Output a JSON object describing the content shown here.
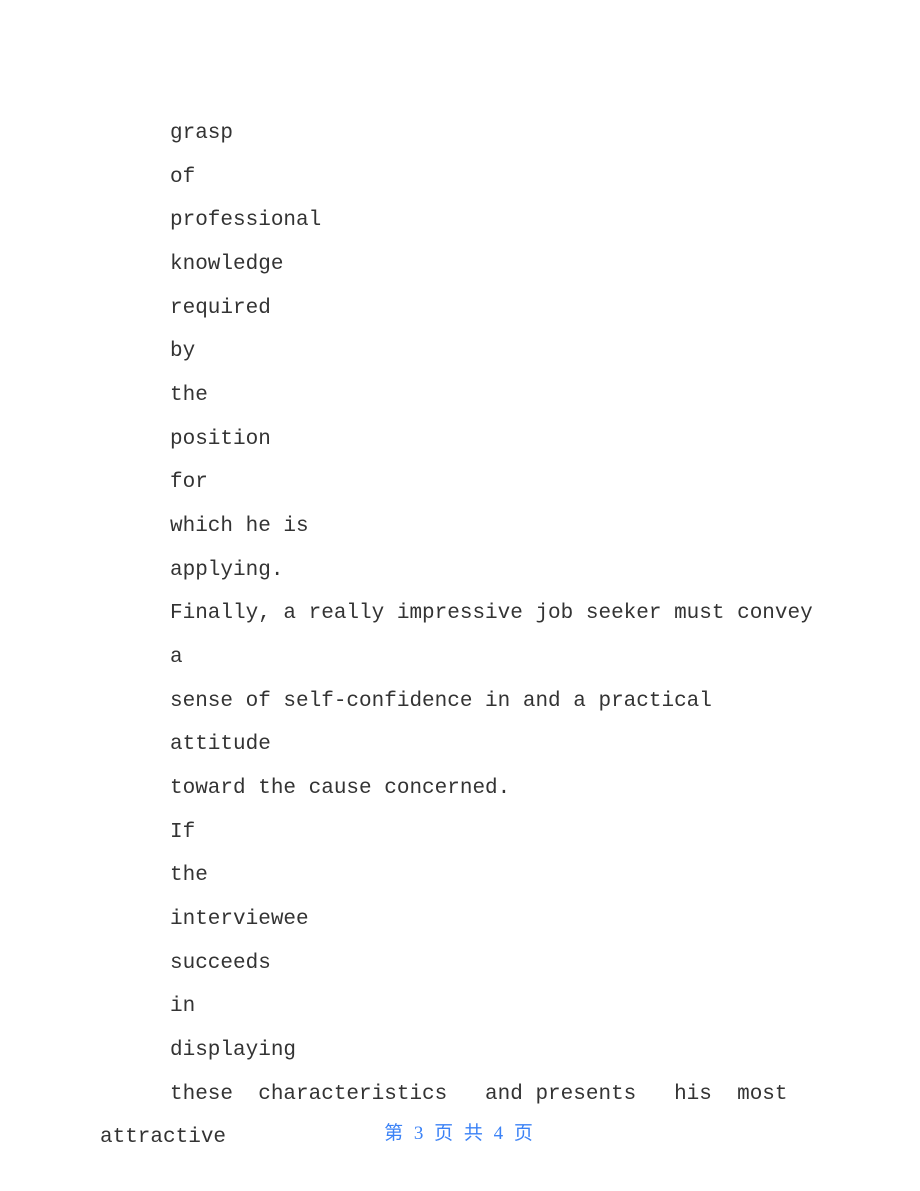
{
  "lines": [
    "grasp",
    "of",
    "professional",
    "knowledge",
    "required",
    "by",
    "the",
    "position",
    "for",
    "which he is",
    "applying.",
    "Finally, a really impressive job seeker must convey a",
    "sense of self-confidence in and a practical attitude",
    "toward the cause concerned.",
    "If",
    "the",
    "interviewee",
    "succeeds",
    "in",
    "displaying",
    "these  characteristics   and presents   his  most"
  ],
  "last_line": "attractive",
  "footer": "第 3 页 共 4 页"
}
